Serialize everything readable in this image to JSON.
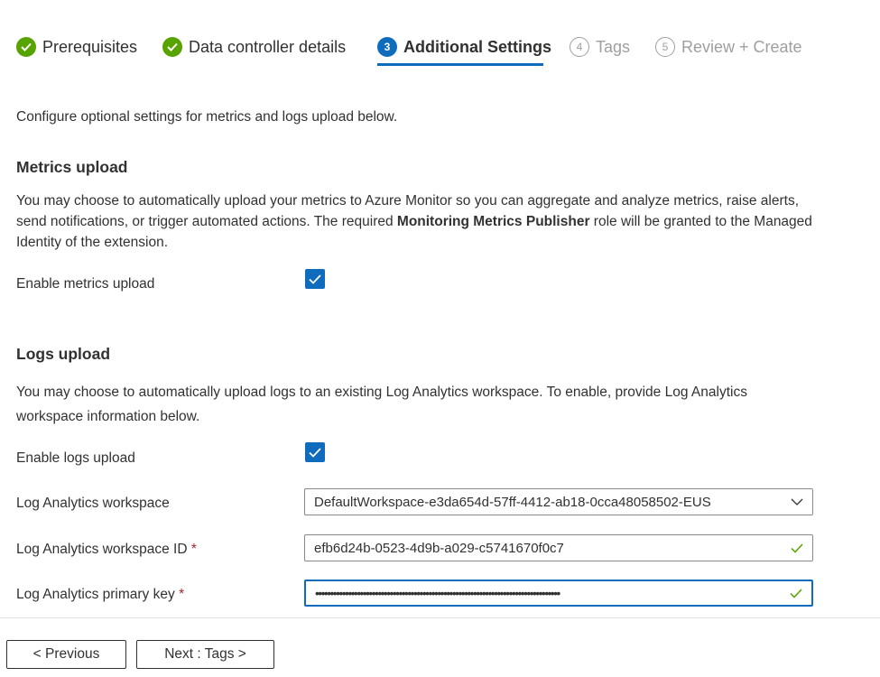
{
  "wizard": {
    "steps": [
      {
        "label": "Prerequisites",
        "state": "done"
      },
      {
        "label": "Data controller details",
        "state": "done"
      },
      {
        "label": "Additional Settings",
        "state": "current",
        "number": "3"
      },
      {
        "label": "Tags",
        "state": "pending",
        "number": "4"
      },
      {
        "label": "Review + Create",
        "state": "pending",
        "number": "5"
      }
    ]
  },
  "intro": "Configure optional settings for metrics and logs upload below.",
  "metrics": {
    "heading": "Metrics upload",
    "desc_part1": "You may choose to automatically upload your metrics to Azure Monitor so you can aggregate and analyze metrics, raise alerts, send notifications, or trigger automated actions. The required ",
    "desc_bold": "Monitoring Metrics Publisher",
    "desc_part2": " role will be granted to the Managed Identity of the extension.",
    "enable_label": "Enable metrics upload",
    "enabled": true
  },
  "logs": {
    "heading": "Logs upload",
    "desc": "You may choose to automatically upload logs to an existing Log Analytics workspace. To enable, provide Log Analytics workspace information below.",
    "enable_label": "Enable logs upload",
    "enabled": true,
    "workspace_label": "Log Analytics workspace",
    "workspace_value": "DefaultWorkspace-e3da654d-57ff-4412-ab18-0cca48058502-EUS",
    "workspace_id_label": "Log Analytics workspace ID",
    "workspace_id_value": "efb6d24b-0523-4d9b-a029-c5741670f0c7",
    "primary_key_label": "Log Analytics primary key",
    "primary_key_value": "••••••••••••••••••••••••••••••••••••••••••••••••••••••••••••••••••••••••••••••••••",
    "required_marker": "*"
  },
  "footer": {
    "previous_label": "< Previous",
    "next_label": "Next : Tags >"
  },
  "colors": {
    "accent": "#0f6cbd",
    "success": "#57a300",
    "required": "#a4262c"
  }
}
